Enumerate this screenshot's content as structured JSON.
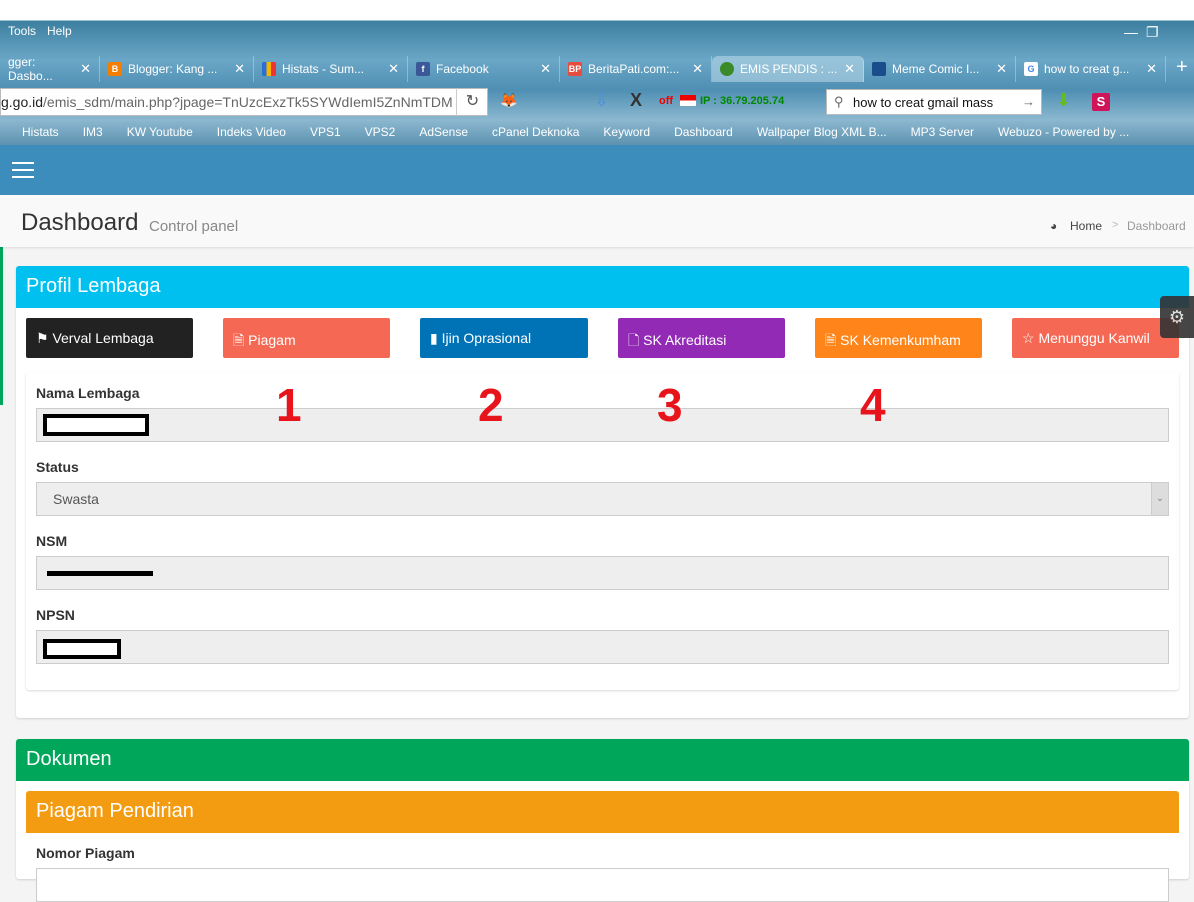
{
  "browser": {
    "menu": [
      "Tools",
      "Help"
    ],
    "tabs": [
      {
        "label": "gger: Dasbo...",
        "icon": "blogger-icon",
        "active": false
      },
      {
        "label": "Blogger: Kang ...",
        "icon": "blogger-icon",
        "active": false
      },
      {
        "label": "Histats - Sum...",
        "icon": "histats-icon",
        "active": false
      },
      {
        "label": "Facebook",
        "icon": "facebook-icon",
        "active": false
      },
      {
        "label": "BeritaPati.com:...",
        "icon": "beritapati-icon",
        "active": false
      },
      {
        "label": "EMIS PENDIS : ...",
        "icon": "emis-icon",
        "active": true
      },
      {
        "label": "Meme Comic I...",
        "icon": "memecomic-icon",
        "active": false
      },
      {
        "label": "how to creat g...",
        "icon": "google-icon",
        "active": false
      }
    ],
    "url_domain": "g.go.id",
    "url_path": "/emis_sdm/main.php?jpage=TnUzcExzTk5SYWdIemI5ZnNmTDM",
    "ip_off": "off",
    "ip_label": "IP : 36.79.205.74",
    "search_value": "how to creat gmail mass",
    "bookmarks": [
      "Histats",
      "IM3",
      "KW Youtube",
      "Indeks Video",
      "VPS1",
      "VPS2",
      "AdSense",
      "cPanel Deknoka",
      "Keyword",
      "Dashboard",
      "Wallpaper Blog XML B...",
      "MP3 Server",
      "Webuzo - Powered by ..."
    ]
  },
  "header": {
    "title": "Dashboard",
    "subtitle": "Control panel",
    "breadcrumb": [
      "Home",
      "Dashboard"
    ]
  },
  "profil": {
    "title": "Profil Lembaga",
    "buttons": [
      {
        "label": "Verval Lembaga",
        "icon": "flag-icon",
        "color": "#222222"
      },
      {
        "label": "Piagam",
        "icon": "file-text-icon",
        "color": "#f56954"
      },
      {
        "label": "Ijin Oprasional",
        "icon": "file-icon",
        "color": "#0073b7"
      },
      {
        "label": "SK Akreditasi",
        "icon": "file-outline-icon",
        "color": "#932ab6"
      },
      {
        "label": "SK Kemenkumham",
        "icon": "file-text-icon",
        "color": "#ff851b"
      },
      {
        "label": "Menunggu Kanwil",
        "icon": "star-icon",
        "color": "#f56954"
      }
    ],
    "annotations": [
      "1",
      "2",
      "3",
      "4"
    ],
    "fields": {
      "nama_label": "Nama Lembaga",
      "status_label": "Status",
      "status_value": "Swasta",
      "nsm_label": "NSM",
      "npsn_label": "NPSN"
    }
  },
  "dokumen": {
    "title": "Dokumen",
    "piagam_title": "Piagam Pendirian",
    "nomor_label": "Nomor Piagam"
  }
}
